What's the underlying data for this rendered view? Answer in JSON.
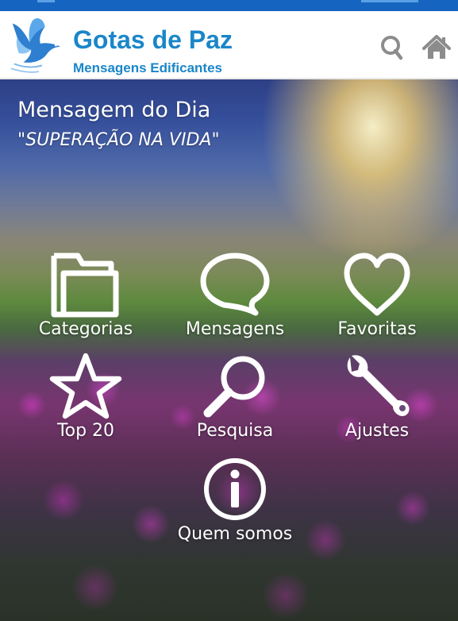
{
  "app": {
    "title": "Gotas de Paz",
    "subtitle": "Mensagens Edificantes",
    "brand_color": "#1a86c9",
    "status_bar_color": "#1565c0",
    "logo_icon": "dove-icon"
  },
  "header": {
    "search_icon": "search-icon",
    "home_icon": "home-icon"
  },
  "daily_message": {
    "heading": "Mensagem do Dia",
    "title": "\"SUPERAÇÃO NA VIDA\""
  },
  "menu": {
    "categorias": {
      "label": "Categorias",
      "icon": "folder-icon"
    },
    "mensagens": {
      "label": "Mensagens",
      "icon": "speech-bubble-icon"
    },
    "favoritas": {
      "label": "Favoritas",
      "icon": "heart-icon"
    },
    "top20": {
      "label": "Top 20",
      "icon": "star-icon"
    },
    "pesquisa": {
      "label": "Pesquisa",
      "icon": "magnifier-icon"
    },
    "ajustes": {
      "label": "Ajustes",
      "icon": "wrench-icon"
    },
    "quem_somos": {
      "label": "Quem somos",
      "icon": "info-icon"
    }
  }
}
